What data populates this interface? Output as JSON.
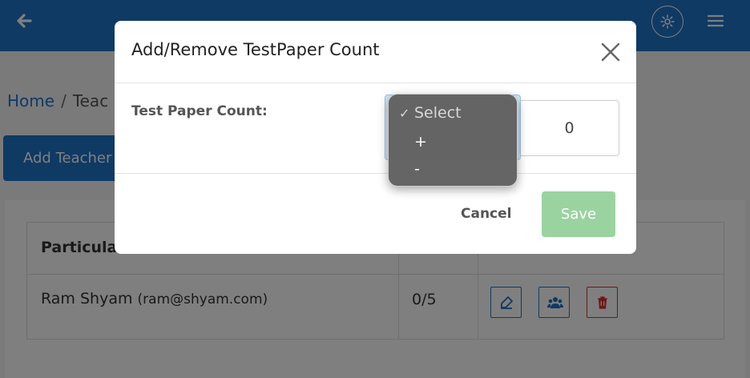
{
  "topbar": {
    "bg_color": "#1e74c8",
    "icons": [
      "arrow-left-icon",
      "gear-icon",
      "hamburger-menu-icon"
    ]
  },
  "breadcrumb": {
    "home": "Home",
    "separator": "/",
    "current": "Teac"
  },
  "page": {
    "add_button_label": "Add Teacher"
  },
  "table": {
    "header_first": "Particula",
    "row": {
      "name": "Ram Shyam",
      "email": "(ram@shyam.com)",
      "count": "0/5"
    }
  },
  "modal": {
    "title": "Add/Remove TestPaper Count",
    "field_label": "Test Paper Count:",
    "count_value": "0",
    "cancel_label": "Cancel",
    "save_label": "Save",
    "save_color": "#9ad3a0"
  },
  "dropdown": {
    "check_mark": "✓",
    "options": [
      "Select",
      "+",
      "-"
    ],
    "selected": "Select"
  }
}
